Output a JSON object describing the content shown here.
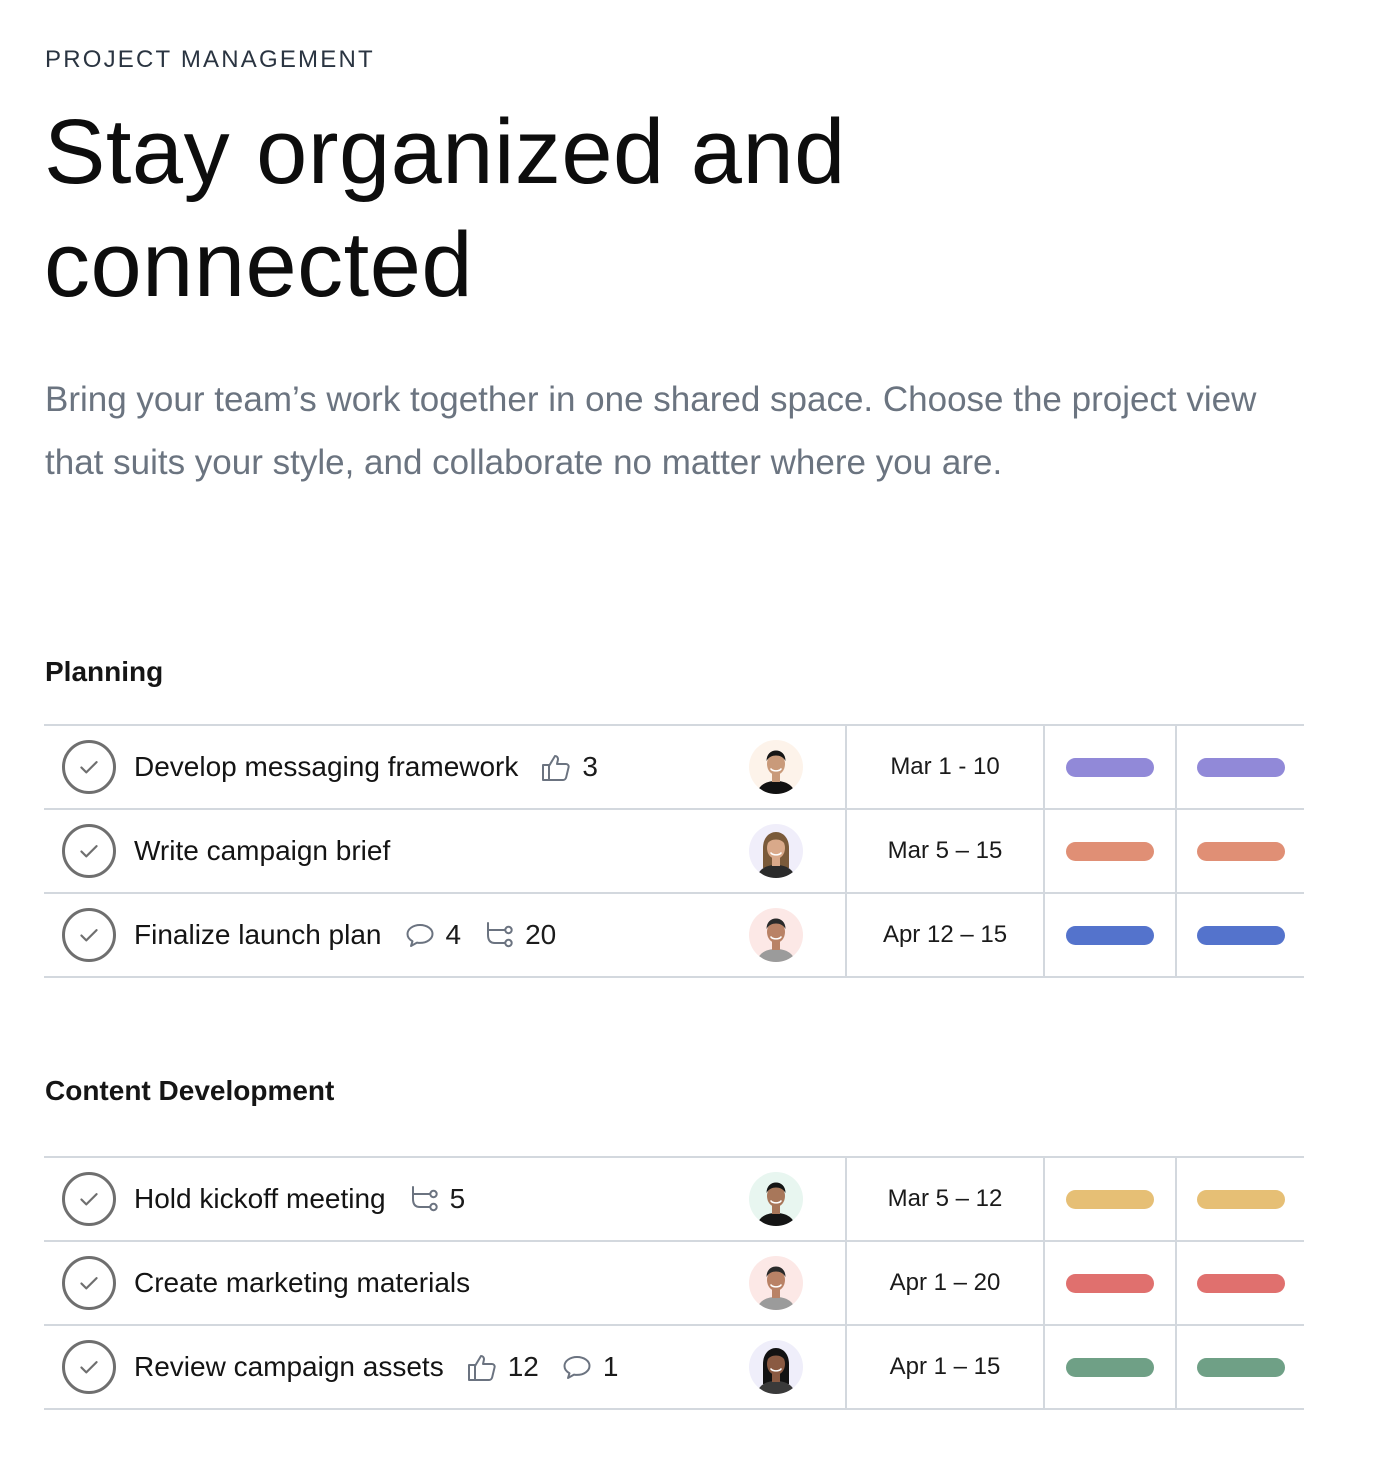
{
  "header": {
    "eyebrow": "PROJECT MANAGEMENT",
    "title": "Stay organized and connected",
    "description": "Bring your team’s work together in one shared space. Choose the project view that suits your style, and collaborate no matter where you are."
  },
  "sections": [
    {
      "title": "Planning",
      "tasks": [
        {
          "name": "Develop messaging framework",
          "likes": "3",
          "comments": null,
          "subtasks": null,
          "assignee": {
            "icon": "avatar-woman-short-hair",
            "bg": "#fdf3ea",
            "skin": "#c99a7a",
            "hair": "#161616",
            "shirt": "#111111"
          },
          "dates": "Mar 1 - 10",
          "color": "#9189d8"
        },
        {
          "name": "Write campaign brief",
          "likes": null,
          "comments": null,
          "subtasks": null,
          "assignee": {
            "icon": "avatar-woman-curly-hair",
            "bg": "#f0eefa",
            "skin": "#d9a98a",
            "hair": "#7a5a3a",
            "shirt": "#2b2b2b"
          },
          "dates": "Mar 5 – 15",
          "color": "#e08f75"
        },
        {
          "name": "Finalize launch plan",
          "likes": null,
          "comments": "4",
          "subtasks": "20",
          "assignee": {
            "icon": "avatar-man-smiling",
            "bg": "#fce8e6",
            "skin": "#b98266",
            "hair": "#2a2a2a",
            "shirt": "#9b9b9b"
          },
          "dates": "Apr 12 – 15",
          "color": "#5473cc"
        }
      ]
    },
    {
      "title": "Content Development",
      "tasks": [
        {
          "name": "Hold kickoff meeting",
          "likes": null,
          "comments": null,
          "subtasks": "5",
          "assignee": {
            "icon": "avatar-man-beard",
            "bg": "#e8f6f0",
            "skin": "#a8775a",
            "hair": "#151515",
            "shirt": "#151515"
          },
          "dates": "Mar 5 – 12",
          "color": "#e6bf75"
        },
        {
          "name": "Create marketing materials",
          "likes": null,
          "comments": null,
          "subtasks": null,
          "assignee": {
            "icon": "avatar-man-smiling",
            "bg": "#fce8e6",
            "skin": "#b98266",
            "hair": "#2a2a2a",
            "shirt": "#9b9b9b"
          },
          "dates": "Apr 1 – 20",
          "color": "#e0706e"
        },
        {
          "name": "Review campaign assets",
          "likes": "12",
          "comments": "1",
          "subtasks": null,
          "assignee": {
            "icon": "avatar-woman-long-hair",
            "bg": "#efeefa",
            "skin": "#8a5a42",
            "hair": "#121212",
            "shirt": "#3a3a3a"
          },
          "dates": "Apr 1 – 15",
          "color": "#6fa086"
        }
      ]
    }
  ]
}
